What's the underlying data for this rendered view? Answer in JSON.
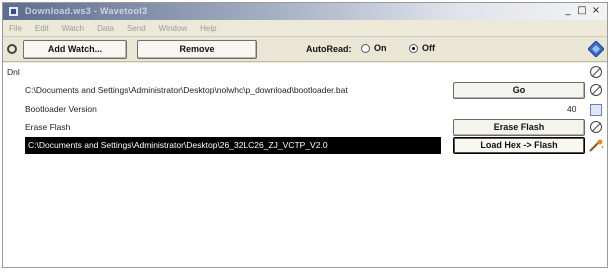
{
  "window": {
    "title": "Download.ws3 - Wavetool3",
    "controls": [
      "_",
      "□",
      "×"
    ]
  },
  "menu": [
    "File",
    "Edit",
    "Watch",
    "Data",
    "Send",
    "Window",
    "Help"
  ],
  "toolbar": {
    "add_watch_label": "Add Watch...",
    "remove_label": "Remove",
    "autoread_label": "AutoRead:",
    "radio_on_label": "On",
    "radio_off_label": "Off",
    "autoread_selected": "Off"
  },
  "rows": {
    "group_label": "Dnl",
    "path_value": "C:\\Documents and Settings\\Administrator\\Desktop\\nolwhc\\p_download\\bootloader.bat",
    "go_label": "Go",
    "bootloader_version_label": "Bootloader Version",
    "bootloader_version_value": "40",
    "erase_flash_label": "Erase Flash",
    "erase_flash_button": "Erase Flash",
    "hex_path_value": "C:\\Documents and Settings\\Administrator\\Desktop\\26_32LC26_ZJ_VCTP_V2.0",
    "load_hex_button": "Load Hex -> Flash"
  },
  "icons": {
    "gear": "gear-icon",
    "diamond": "diamond-icon",
    "no_entry": "circle-slash-icon",
    "refresh": "square-refresh-icon",
    "wand": "wand-icon"
  },
  "colors": {
    "selection": "#000000",
    "diamond": "#3a6fd0"
  }
}
